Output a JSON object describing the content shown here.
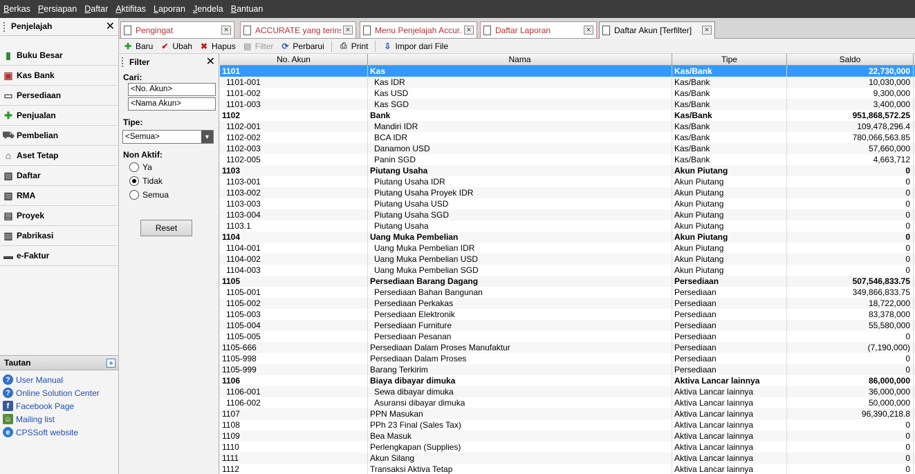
{
  "menu": [
    "Berkas",
    "Persiapan",
    "Daftar",
    "Aktifitas",
    "Laporan",
    "Jendela",
    "Bantuan"
  ],
  "navigator": {
    "title": "Penjelajah",
    "items": [
      {
        "label": "Buku Besar",
        "icon": "ledger-icon"
      },
      {
        "label": "Kas Bank",
        "icon": "bank-icon"
      },
      {
        "label": "Persediaan",
        "icon": "inventory-icon"
      },
      {
        "label": "Penjualan",
        "icon": "sales-icon"
      },
      {
        "label": "Pembelian",
        "icon": "cart-icon"
      },
      {
        "label": "Aset Tetap",
        "icon": "house-icon"
      },
      {
        "label": "Daftar",
        "icon": "list-icon"
      },
      {
        "label": "RMA",
        "icon": "rma-icon"
      },
      {
        "label": "Proyek",
        "icon": "project-icon"
      },
      {
        "label": "Pabrikasi",
        "icon": "factory-icon"
      },
      {
        "label": "e-Faktur",
        "icon": "invoice-icon"
      }
    ]
  },
  "tautan": {
    "title": "Tautan",
    "links": [
      {
        "label": "User Manual",
        "icon": "help-icon",
        "color": "#2f6fc8"
      },
      {
        "label": "Online Solution Center",
        "icon": "help-icon",
        "color": "#2f6fc8"
      },
      {
        "label": "Facebook Page",
        "icon": "facebook-icon",
        "color": "#3b5998"
      },
      {
        "label": "Mailing list",
        "icon": "people-icon",
        "color": "#5a8a3a"
      },
      {
        "label": "CPSSoft website",
        "icon": "ie-icon",
        "color": "#2a7bd0"
      }
    ]
  },
  "tabs": [
    {
      "label": "Pengingat",
      "active": false
    },
    {
      "label": "ACCURATE yang terinstall t...",
      "active": false
    },
    {
      "label": "Menu Penjelajah Accur...",
      "active": false
    },
    {
      "label": "Daftar Laporan",
      "active": false
    },
    {
      "label": "Daftar Akun [Terfilter]",
      "active": true
    }
  ],
  "toolbar": {
    "baru": "Baru",
    "ubah": "Ubah",
    "hapus": "Hapus",
    "filter": "Filter",
    "perbarui": "Perbarui",
    "print": "Print",
    "impor": "Impor dari File"
  },
  "filter": {
    "title": "Filter",
    "cari_label": "Cari:",
    "no_akun_placeholder": "<No. Akun>",
    "nama_akun_placeholder": "<Nama Akun>",
    "tipe_label": "Tipe:",
    "tipe_value": "<Semua>",
    "nonaktif_label": "Non Aktif:",
    "radio": [
      "Ya",
      "Tidak",
      "Semua"
    ],
    "radio_selected": "Tidak",
    "reset": "Reset"
  },
  "grid": {
    "columns": [
      "No. Akun",
      "Nama",
      "Tipe",
      "Saldo"
    ],
    "rows": [
      {
        "no": "1101",
        "nama": "Kas",
        "tipe": "Kas/Bank",
        "saldo": "22,730,000",
        "bold": true,
        "selected": true
      },
      {
        "no": "1101-001",
        "nama": "Kas IDR",
        "tipe": "Kas/Bank",
        "saldo": "10,030,000",
        "sub": true
      },
      {
        "no": "1101-002",
        "nama": "Kas USD",
        "tipe": "Kas/Bank",
        "saldo": "9,300,000",
        "sub": true
      },
      {
        "no": "1101-003",
        "nama": "Kas SGD",
        "tipe": "Kas/Bank",
        "saldo": "3,400,000",
        "sub": true
      },
      {
        "no": "1102",
        "nama": "Bank",
        "tipe": "Kas/Bank",
        "saldo": "951,868,572.25",
        "bold": true
      },
      {
        "no": "1102-001",
        "nama": "Mandiri IDR",
        "tipe": "Kas/Bank",
        "saldo": "109,478,296.4",
        "sub": true
      },
      {
        "no": "1102-002",
        "nama": "BCA IDR",
        "tipe": "Kas/Bank",
        "saldo": "780,066,563.85",
        "sub": true
      },
      {
        "no": "1102-003",
        "nama": "Danamon USD",
        "tipe": "Kas/Bank",
        "saldo": "57,660,000",
        "sub": true
      },
      {
        "no": "1102-005",
        "nama": "Panin SGD",
        "tipe": "Kas/Bank",
        "saldo": "4,663,712",
        "sub": true
      },
      {
        "no": "1103",
        "nama": "Piutang Usaha",
        "tipe": "Akun Piutang",
        "saldo": "0",
        "bold": true
      },
      {
        "no": "1103-001",
        "nama": "Piutang Usaha IDR",
        "tipe": "Akun Piutang",
        "saldo": "0",
        "sub": true
      },
      {
        "no": "1103-002",
        "nama": "Piutang Usaha Proyek IDR",
        "tipe": "Akun Piutang",
        "saldo": "0",
        "sub": true
      },
      {
        "no": "1103-003",
        "nama": "Piutang Usaha USD",
        "tipe": "Akun Piutang",
        "saldo": "0",
        "sub": true
      },
      {
        "no": "1103-004",
        "nama": "Piutang Usaha SGD",
        "tipe": "Akun Piutang",
        "saldo": "0",
        "sub": true
      },
      {
        "no": "1103.1",
        "nama": "Piutang Usaha",
        "tipe": "Akun Piutang",
        "saldo": "0",
        "sub": true
      },
      {
        "no": "1104",
        "nama": "Uang Muka Pembelian",
        "tipe": "Akun Piutang",
        "saldo": "0",
        "bold": true
      },
      {
        "no": "1104-001",
        "nama": "Uang Muka Pembelian IDR",
        "tipe": "Akun Piutang",
        "saldo": "0",
        "sub": true
      },
      {
        "no": "1104-002",
        "nama": "Uang Muka Pembelian USD",
        "tipe": "Akun Piutang",
        "saldo": "0",
        "sub": true
      },
      {
        "no": "1104-003",
        "nama": "Uang Muka Pembelian SGD",
        "tipe": "Akun Piutang",
        "saldo": "0",
        "sub": true
      },
      {
        "no": "1105",
        "nama": "Persediaan Barang Dagang",
        "tipe": "Persediaan",
        "saldo": "507,546,833.75",
        "bold": true
      },
      {
        "no": "1105-001",
        "nama": "Persediaan Bahan Bangunan",
        "tipe": "Persediaan",
        "saldo": "349,866,833.75",
        "sub": true
      },
      {
        "no": "1105-002",
        "nama": "Persediaan Perkakas",
        "tipe": "Persediaan",
        "saldo": "18,722,000",
        "sub": true
      },
      {
        "no": "1105-003",
        "nama": "Persediaan Elektronik",
        "tipe": "Persediaan",
        "saldo": "83,378,000",
        "sub": true
      },
      {
        "no": "1105-004",
        "nama": "Persediaan Furniture",
        "tipe": "Persediaan",
        "saldo": "55,580,000",
        "sub": true
      },
      {
        "no": "1105-005",
        "nama": "Persediaan Pesanan",
        "tipe": "Persediaan",
        "saldo": "0",
        "sub": true
      },
      {
        "no": "1105-666",
        "nama": "Persediaan Dalam Proses Manufaktur",
        "tipe": "Persediaan",
        "saldo": "(7,190,000)"
      },
      {
        "no": "1105-998",
        "nama": "Persediaan Dalam Proses",
        "tipe": "Persediaan",
        "saldo": "0"
      },
      {
        "no": "1105-999",
        "nama": "Barang Terkirim",
        "tipe": "Persediaan",
        "saldo": "0"
      },
      {
        "no": "1106",
        "nama": "Biaya dibayar dimuka",
        "tipe": "Aktiva Lancar lainnya",
        "saldo": "86,000,000",
        "bold": true
      },
      {
        "no": "1106-001",
        "nama": "Sewa dibayar dimuka",
        "tipe": "Aktiva Lancar lainnya",
        "saldo": "36,000,000",
        "sub": true
      },
      {
        "no": "1106-002",
        "nama": "Asuransi dibayar dimuka",
        "tipe": "Aktiva Lancar lainnya",
        "saldo": "50,000,000",
        "sub": true
      },
      {
        "no": "1107",
        "nama": "PPN Masukan",
        "tipe": "Aktiva Lancar lainnya",
        "saldo": "96,390,218.8"
      },
      {
        "no": "1108",
        "nama": "PPh 23 Final (Sales Tax)",
        "tipe": "Aktiva Lancar lainnya",
        "saldo": "0"
      },
      {
        "no": "1109",
        "nama": "Bea Masuk",
        "tipe": "Aktiva Lancar lainnya",
        "saldo": "0"
      },
      {
        "no": "1110",
        "nama": "Perlengkapan (Supplies)",
        "tipe": "Aktiva Lancar lainnya",
        "saldo": "0"
      },
      {
        "no": "1111",
        "nama": "Akun Silang",
        "tipe": "Aktiva Lancar lainnya",
        "saldo": "0"
      },
      {
        "no": "1112",
        "nama": "Transaksi Aktiva Tetap",
        "tipe": "Aktiva Lancar lainnya",
        "saldo": "0"
      }
    ]
  }
}
